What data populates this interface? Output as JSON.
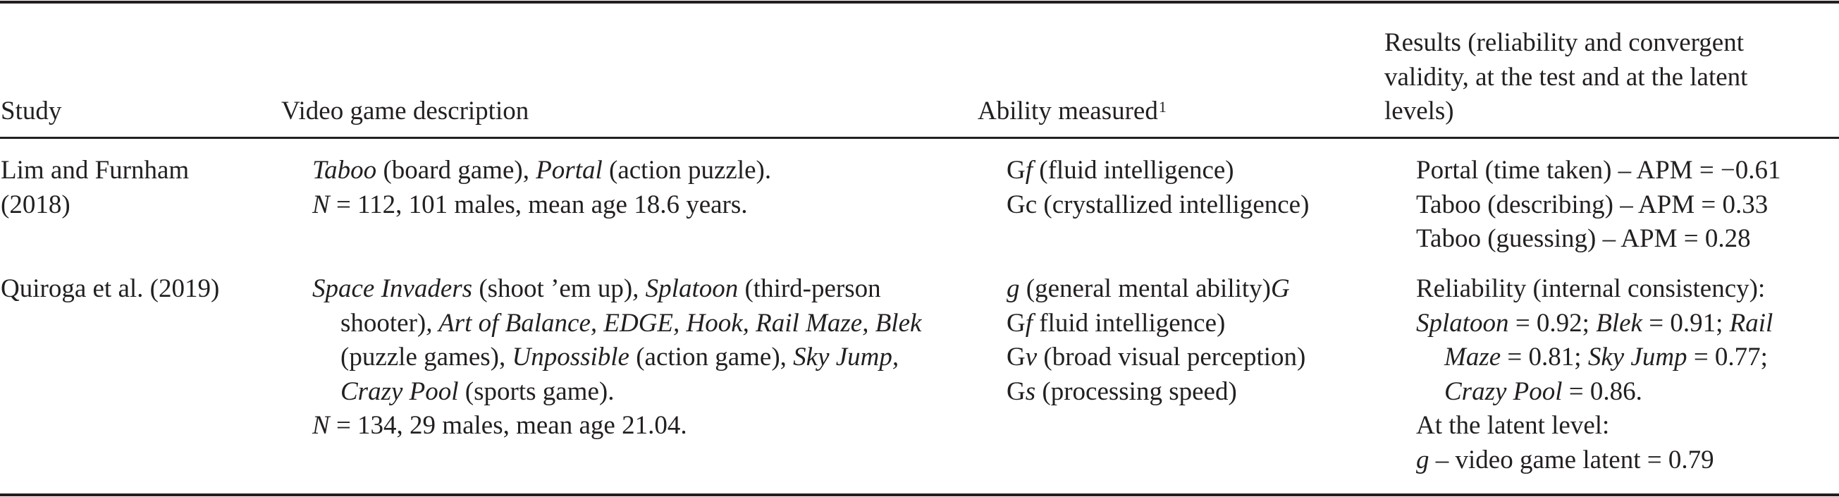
{
  "table": {
    "headers": {
      "study": "Study",
      "description": "Video game description",
      "ability": "Ability measured",
      "ability_footnote": "1",
      "results_lines": [
        "Results (reliability and convergent",
        "validity, at the test and at the latent",
        "levels)"
      ]
    },
    "rows": [
      {
        "study_lines": [
          "Lim and Furnham",
          "(2018)"
        ],
        "description": {
          "line1": {
            "game1": "Taboo",
            "game1_genre": " (board game), ",
            "game2": "Portal",
            "game2_genre": " (action puzzle)."
          },
          "sample_N": "N",
          "sample_rest": " = 112, 101 males, mean age 18.6 years."
        },
        "abilities": [
          {
            "prefix": "G",
            "italic": "f",
            "rest": " (fluid intelligence)"
          },
          {
            "prefix": "Gc",
            "italic": "",
            "rest": " (crystallized intelligence)"
          }
        ],
        "results_lines": [
          "Portal (time taken) – APM = −0.61",
          "Taboo (describing) – APM = 0.33",
          "Taboo (guessing) – APM = 0.28"
        ]
      },
      {
        "study_lines": [
          "Quiroga et al. (2019)"
        ],
        "description": {
          "l1_game1": "Space Invaders",
          "l1_text1": " (shoot ’em up)",
          "l1_comma": ", ",
          "l1_game2": "Splatoon",
          "l1_text2": " (third-person",
          "l2_text1": "shooter)",
          "l2_games": ", Art of Balance, EDGE, Hook, Rail Maze, Blek",
          "l3_text1": "(puzzle games), ",
          "l3_game1": "Unpossible",
          "l3_text2": " (action game), ",
          "l3_game2": "Sky Jump,",
          "l4_game1": "Crazy Pool",
          "l4_text1": " (sports game).",
          "sample_N": "N",
          "sample_rest": " = 134, 29 males, mean age 21.04."
        },
        "abilities": [
          {
            "prefix": "",
            "italic": "g",
            "rest": " (general mental ability)",
            "trailing_italic": "G"
          },
          {
            "prefix": "G",
            "italic": "f",
            "rest": " fluid intelligence)"
          },
          {
            "prefix": "G",
            "italic": "v",
            "rest": " (broad visual perception)"
          },
          {
            "prefix": "G",
            "italic": "s",
            "rest": " (processing speed)"
          }
        ],
        "results": {
          "reliability_label": "Reliability (internal consistency):",
          "l2": {
            "g1": "Splatoon",
            "v1": " = 0.92; ",
            "g2": "Blek",
            "v2": " = 0.91; ",
            "g3a": "Rail"
          },
          "l3": {
            "g3b": "Maze",
            "v3": " = 0.81; ",
            "g4": "Sky Jump",
            "v4": " = 0.77;"
          },
          "l4": {
            "g5": "Crazy Pool",
            "v5": " = 0.86."
          },
          "latent_label": "At the latent level:",
          "latent": {
            "g": "g",
            "rest": " – video game latent = 0.79"
          }
        }
      }
    ]
  }
}
